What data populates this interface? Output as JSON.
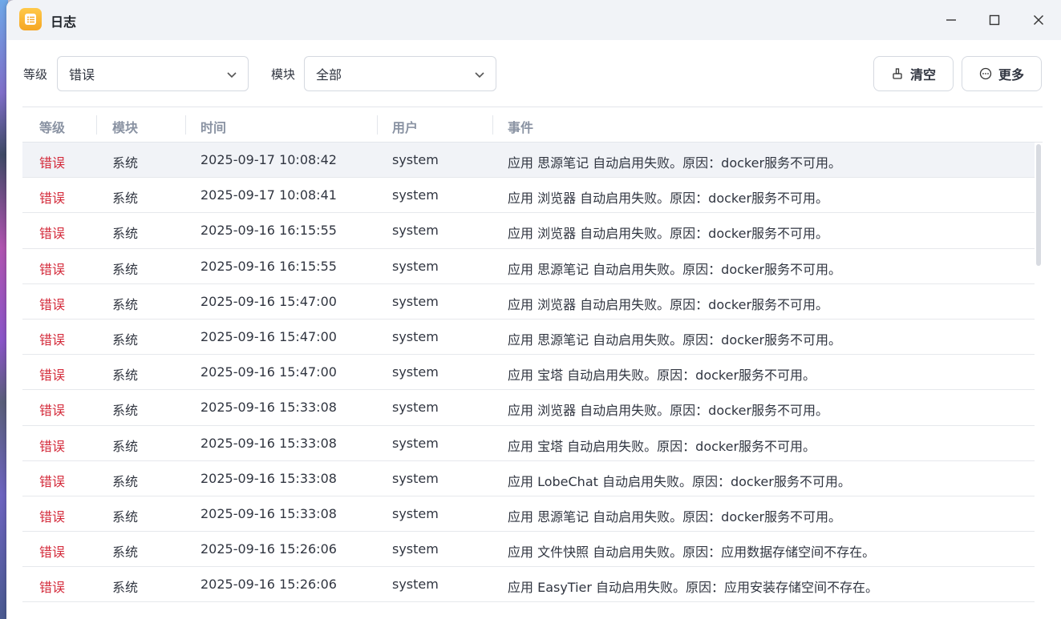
{
  "window": {
    "title": "日志",
    "app_icon": "list-icon"
  },
  "filters": {
    "level_label": "等级",
    "level_value": "错误",
    "module_label": "模块",
    "module_value": "全部"
  },
  "actions": {
    "clear_label": "清空",
    "more_label": "更多"
  },
  "table": {
    "columns": [
      "等级",
      "模块",
      "时间",
      "用户",
      "事件"
    ],
    "rows": [
      {
        "level": "错误",
        "module": "系统",
        "time": "2025-09-17 10:08:42",
        "user": "system",
        "event": "应用 思源笔记 自动启用失败。原因：docker服务不可用。"
      },
      {
        "level": "错误",
        "module": "系统",
        "time": "2025-09-17 10:08:41",
        "user": "system",
        "event": "应用 浏览器 自动启用失败。原因：docker服务不可用。"
      },
      {
        "level": "错误",
        "module": "系统",
        "time": "2025-09-16 16:15:55",
        "user": "system",
        "event": "应用 浏览器 自动启用失败。原因：docker服务不可用。"
      },
      {
        "level": "错误",
        "module": "系统",
        "time": "2025-09-16 16:15:55",
        "user": "system",
        "event": "应用 思源笔记 自动启用失败。原因：docker服务不可用。"
      },
      {
        "level": "错误",
        "module": "系统",
        "time": "2025-09-16 15:47:00",
        "user": "system",
        "event": "应用 浏览器 自动启用失败。原因：docker服务不可用。"
      },
      {
        "level": "错误",
        "module": "系统",
        "time": "2025-09-16 15:47:00",
        "user": "system",
        "event": "应用 思源笔记 自动启用失败。原因：docker服务不可用。"
      },
      {
        "level": "错误",
        "module": "系统",
        "time": "2025-09-16 15:47:00",
        "user": "system",
        "event": "应用 宝塔 自动启用失败。原因：docker服务不可用。"
      },
      {
        "level": "错误",
        "module": "系统",
        "time": "2025-09-16 15:33:08",
        "user": "system",
        "event": "应用 浏览器 自动启用失败。原因：docker服务不可用。"
      },
      {
        "level": "错误",
        "module": "系统",
        "time": "2025-09-16 15:33:08",
        "user": "system",
        "event": "应用 宝塔 自动启用失败。原因：docker服务不可用。"
      },
      {
        "level": "错误",
        "module": "系统",
        "time": "2025-09-16 15:33:08",
        "user": "system",
        "event": "应用 LobeChat 自动启用失败。原因：docker服务不可用。"
      },
      {
        "level": "错误",
        "module": "系统",
        "time": "2025-09-16 15:33:08",
        "user": "system",
        "event": "应用 思源笔记 自动启用失败。原因：docker服务不可用。"
      },
      {
        "level": "错误",
        "module": "系统",
        "time": "2025-09-16 15:26:06",
        "user": "system",
        "event": "应用 文件快照 自动启用失败。原因：应用数据存储空间不存在。"
      },
      {
        "level": "错误",
        "module": "系统",
        "time": "2025-09-16 15:26:06",
        "user": "system",
        "event": "应用 EasyTier 自动启用失败。原因：应用安装存储空间不存在。"
      }
    ]
  },
  "colors": {
    "error": "#d42c3c",
    "accent": "#f5a623"
  }
}
